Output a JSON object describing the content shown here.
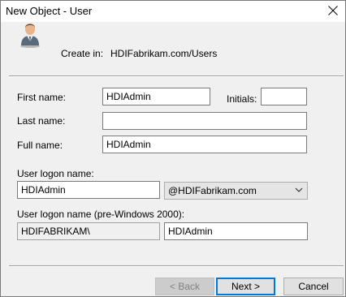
{
  "window": {
    "title": "New Object - User"
  },
  "header": {
    "create_in_label": "Create in:",
    "create_in_path": "HDIFabrikam.com/Users"
  },
  "form": {
    "first_name_label": "First name:",
    "first_name_value": "HDIAdmin",
    "initials_label": "Initials:",
    "initials_value": "",
    "last_name_label": "Last name:",
    "last_name_value": "",
    "full_name_label": "Full name:",
    "full_name_value": "HDIAdmin",
    "logon_name_label": "User logon name:",
    "logon_name_value": "HDIAdmin",
    "domain_suffix_value": "@HDIFabrikam.com",
    "pre2000_label": "User logon name (pre-Windows 2000):",
    "pre2000_domain_value": "HDIFABRIKAM\\",
    "pre2000_name_value": "HDIAdmin"
  },
  "buttons": {
    "back_label": "< Back",
    "next_label": "Next >",
    "cancel_label": "Cancel"
  }
}
